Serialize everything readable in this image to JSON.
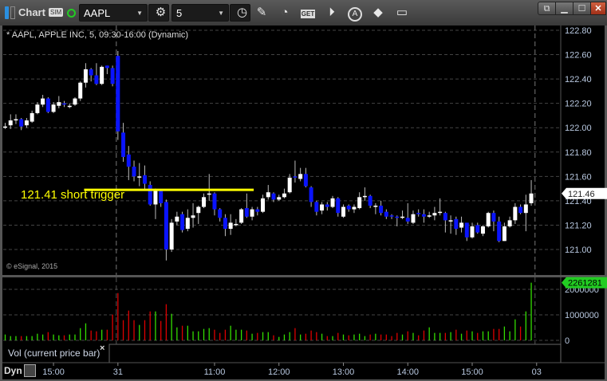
{
  "toolbar": {
    "app_label": "Chart",
    "sim_badge": "SIM",
    "symbol": "AAPL",
    "interval": "5",
    "icons": [
      "layout-icon",
      "gear-icon",
      "clock-icon",
      "pencil-icon",
      "speedometer-icon",
      "get-icon",
      "play-icon",
      "a-icon",
      "tag-icon",
      "comment-icon"
    ],
    "get_label": "GET",
    "a_label": "A"
  },
  "window_buttons": [
    "restore-icon",
    "minimize-icon",
    "maximize-icon",
    "close-icon"
  ],
  "colors": {
    "up": "#ffffff",
    "down": "#0a14ff",
    "vol_up": "#33dd00",
    "vol_down": "#dd0000",
    "trigger": "#ffff00",
    "status": "#22cc22"
  },
  "chart_data": {
    "type": "candlestick",
    "title": "* AAPL, APPLE INC, 5, 09:30-16:00 (Dynamic)",
    "copyright": "© eSignal, 2015",
    "ylim": [
      120.9,
      122.85
    ],
    "yticks": [
      "122.80",
      "122.60",
      "122.40",
      "122.20",
      "122.00",
      "121.80",
      "121.60",
      "121.40",
      "121.20",
      "121.00"
    ],
    "last_price": "121.46",
    "annotation": {
      "label": "121.41 short trigger",
      "price": 121.49,
      "from_bar": 15,
      "to_bar": 46
    },
    "xticks": [
      {
        "bar": 9,
        "label": "15:00"
      },
      {
        "bar": 21,
        "label": "31"
      },
      {
        "bar": 39,
        "label": "11:00"
      },
      {
        "bar": 51,
        "label": "12:00"
      },
      {
        "bar": 63,
        "label": "13:00"
      },
      {
        "bar": 75,
        "label": "14:00"
      },
      {
        "bar": 87,
        "label": "15:00"
      },
      {
        "bar": 99,
        "label": "03"
      }
    ],
    "session_breaks": [
      21,
      99
    ],
    "ohlc": [
      [
        122.01,
        122.04,
        121.99,
        122.01
      ],
      [
        122.02,
        122.11,
        121.99,
        122.06
      ],
      [
        122.06,
        122.11,
        122.03,
        122.07
      ],
      [
        122.07,
        122.08,
        121.98,
        122.01
      ],
      [
        122.02,
        122.08,
        122.0,
        122.06
      ],
      [
        122.05,
        122.14,
        122.04,
        122.12
      ],
      [
        122.12,
        122.21,
        122.11,
        122.19
      ],
      [
        122.19,
        122.27,
        122.17,
        122.24
      ],
      [
        122.24,
        122.25,
        122.12,
        122.13
      ],
      [
        122.13,
        122.21,
        122.12,
        122.19
      ],
      [
        122.18,
        122.26,
        122.16,
        122.21
      ],
      [
        122.2,
        122.22,
        122.17,
        122.19
      ],
      [
        122.18,
        122.2,
        122.16,
        122.18
      ],
      [
        122.19,
        122.25,
        122.18,
        122.24
      ],
      [
        122.24,
        122.38,
        122.22,
        122.37
      ],
      [
        122.37,
        122.53,
        122.33,
        122.48
      ],
      [
        122.48,
        122.49,
        122.38,
        122.43
      ],
      [
        122.43,
        122.53,
        122.35,
        122.36
      ],
      [
        122.36,
        122.51,
        122.35,
        122.5
      ],
      [
        122.51,
        122.51,
        122.44,
        122.49
      ],
      [
        122.49,
        122.51,
        122.34,
        122.36
      ],
      [
        122.59,
        122.63,
        121.9,
        121.97
      ],
      [
        121.96,
        122.04,
        121.72,
        121.76
      ],
      [
        121.78,
        121.85,
        121.57,
        121.68
      ],
      [
        121.68,
        121.73,
        121.56,
        121.6
      ],
      [
        121.6,
        121.71,
        121.52,
        121.6
      ],
      [
        121.61,
        121.69,
        121.49,
        121.54
      ],
      [
        121.53,
        121.56,
        121.36,
        121.37
      ],
      [
        121.37,
        121.5,
        121.25,
        121.49
      ],
      [
        121.48,
        121.49,
        121.35,
        121.38
      ],
      [
        121.39,
        121.41,
        120.91,
        121.0
      ],
      [
        121.0,
        121.25,
        120.98,
        121.22
      ],
      [
        121.23,
        121.31,
        121.2,
        121.27
      ],
      [
        121.29,
        121.31,
        121.14,
        121.16
      ],
      [
        121.17,
        121.33,
        121.15,
        121.26
      ],
      [
        121.26,
        121.38,
        121.18,
        121.28
      ],
      [
        121.3,
        121.36,
        121.21,
        121.35
      ],
      [
        121.35,
        121.46,
        121.34,
        121.43
      ],
      [
        121.45,
        121.62,
        121.4,
        121.46
      ],
      [
        121.46,
        121.47,
        121.28,
        121.33
      ],
      [
        121.33,
        121.34,
        121.23,
        121.26
      ],
      [
        121.26,
        121.29,
        121.11,
        121.17
      ],
      [
        121.17,
        121.29,
        121.12,
        121.22
      ],
      [
        121.21,
        121.25,
        121.19,
        121.21
      ],
      [
        121.22,
        121.34,
        121.21,
        121.33
      ],
      [
        121.34,
        121.46,
        121.26,
        121.27
      ],
      [
        121.27,
        121.35,
        121.24,
        121.33
      ],
      [
        121.33,
        121.35,
        121.28,
        121.31
      ],
      [
        121.31,
        121.45,
        121.3,
        121.42
      ],
      [
        121.43,
        121.53,
        121.41,
        121.47
      ],
      [
        121.46,
        121.47,
        121.39,
        121.41
      ],
      [
        121.41,
        121.45,
        121.4,
        121.43
      ],
      [
        121.43,
        121.5,
        121.42,
        121.46
      ],
      [
        121.47,
        121.62,
        121.46,
        121.59
      ],
      [
        121.6,
        121.73,
        121.55,
        121.59
      ],
      [
        121.58,
        121.67,
        121.56,
        121.62
      ],
      [
        121.62,
        121.67,
        121.51,
        121.52
      ],
      [
        121.51,
        121.52,
        121.35,
        121.39
      ],
      [
        121.39,
        121.4,
        121.28,
        121.31
      ],
      [
        121.32,
        121.39,
        121.29,
        121.37
      ],
      [
        121.37,
        121.39,
        121.32,
        121.35
      ],
      [
        121.35,
        121.44,
        121.34,
        121.42
      ],
      [
        121.42,
        121.43,
        121.27,
        121.3
      ],
      [
        121.27,
        121.37,
        121.26,
        121.35
      ],
      [
        121.36,
        121.37,
        121.31,
        121.33
      ],
      [
        121.33,
        121.37,
        121.3,
        121.35
      ],
      [
        121.34,
        121.47,
        121.33,
        121.43
      ],
      [
        121.43,
        121.51,
        121.4,
        121.44
      ],
      [
        121.44,
        121.45,
        121.34,
        121.36
      ],
      [
        121.35,
        121.38,
        121.29,
        121.36
      ],
      [
        121.36,
        121.4,
        121.28,
        121.3
      ],
      [
        121.31,
        121.33,
        121.25,
        121.27
      ],
      [
        121.28,
        121.29,
        121.25,
        121.27
      ],
      [
        121.27,
        121.28,
        121.19,
        121.26
      ],
      [
        121.26,
        121.32,
        121.25,
        121.27
      ],
      [
        121.26,
        121.38,
        121.21,
        121.23
      ],
      [
        121.22,
        121.32,
        121.21,
        121.29
      ],
      [
        121.3,
        121.33,
        121.27,
        121.29
      ],
      [
        121.29,
        121.33,
        121.22,
        121.27
      ],
      [
        121.27,
        121.31,
        121.26,
        121.28
      ],
      [
        121.28,
        121.35,
        121.24,
        121.3
      ],
      [
        121.3,
        121.42,
        121.28,
        121.31
      ],
      [
        121.3,
        121.31,
        121.14,
        121.24
      ],
      [
        121.23,
        121.28,
        121.13,
        121.24
      ],
      [
        121.25,
        121.27,
        121.12,
        121.17
      ],
      [
        121.18,
        121.27,
        121.14,
        121.22
      ],
      [
        121.22,
        121.22,
        121.07,
        121.1
      ],
      [
        121.1,
        121.22,
        121.09,
        121.19
      ],
      [
        121.2,
        121.22,
        121.13,
        121.14
      ],
      [
        121.13,
        121.2,
        121.11,
        121.19
      ],
      [
        121.19,
        121.31,
        121.18,
        121.3
      ],
      [
        121.3,
        121.32,
        121.15,
        121.23
      ],
      [
        121.23,
        121.27,
        121.06,
        121.07
      ],
      [
        121.07,
        121.22,
        121.07,
        121.19
      ],
      [
        121.19,
        121.27,
        121.18,
        121.24
      ],
      [
        121.24,
        121.38,
        121.21,
        121.35
      ],
      [
        121.35,
        121.37,
        121.29,
        121.3
      ],
      [
        121.3,
        121.45,
        121.15,
        121.37
      ],
      [
        121.38,
        121.57,
        121.36,
        121.46
      ]
    ],
    "volume": {
      "label": "Vol (current price bar)",
      "close_label": "×",
      "last_value": "2261281",
      "ylim": [
        0,
        2600000
      ],
      "yticks": [
        "2000000",
        "1000000",
        "0"
      ],
      "values_k": [
        229,
        167,
        167,
        167,
        167,
        167,
        260,
        229,
        323,
        229,
        198,
        198,
        229,
        229,
        479,
        667,
        385,
        354,
        417,
        417,
        1010,
        1854,
        792,
        1167,
        792,
        604,
        792,
        1135,
        1135,
        760,
        1417,
        1042,
        510,
        573,
        573,
        354,
        354,
        448,
        479,
        417,
        292,
        417,
        573,
        417,
        417,
        385,
        260,
        292,
        323,
        323,
        198,
        135,
        229,
        323,
        479,
        229,
        260,
        385,
        323,
        260,
        167,
        167,
        292,
        229,
        198,
        229,
        260,
        167,
        229,
        260,
        229,
        229,
        167,
        292,
        229,
        354,
        292,
        198,
        385,
        510,
        292,
        292,
        292,
        323,
        417,
        260,
        385,
        354,
        292,
        354,
        354,
        448,
        448,
        542,
        354,
        823,
        542,
        1135,
        2261
      ],
      "up": [
        1,
        1,
        1,
        0,
        1,
        1,
        1,
        1,
        0,
        1,
        1,
        0,
        1,
        1,
        1,
        1,
        0,
        0,
        1,
        0,
        0,
        0,
        0,
        0,
        0,
        1,
        0,
        0,
        1,
        0,
        0,
        1,
        1,
        0,
        1,
        1,
        1,
        1,
        1,
        0,
        0,
        0,
        1,
        1,
        1,
        0,
        1,
        0,
        1,
        1,
        0,
        1,
        1,
        1,
        0,
        1,
        0,
        0,
        0,
        1,
        0,
        1,
        0,
        1,
        0,
        1,
        1,
        1,
        0,
        1,
        0,
        0,
        0,
        0,
        1,
        0,
        1,
        0,
        0,
        1,
        1,
        1,
        0,
        1,
        0,
        1,
        0,
        1,
        0,
        1,
        1,
        0,
        0,
        1,
        1,
        1,
        0,
        1,
        1
      ]
    },
    "footer_label": "Dyn"
  }
}
